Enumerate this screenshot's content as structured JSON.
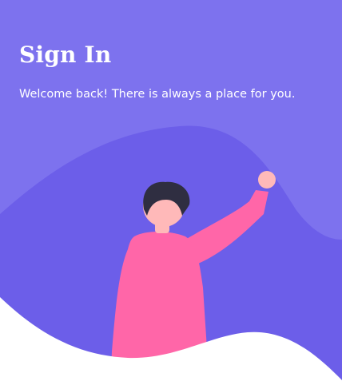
{
  "header": {
    "title": "Sign In",
    "subtitle": "Welcome back! There is always a place for you."
  },
  "illustration": {
    "subject": "waving-person",
    "colors": {
      "background_top": "#7d72ee",
      "background_wave": "#6c5ee9",
      "shirt": "#ff66a8",
      "skin": "#ffb9b9",
      "hair": "#2f2e41",
      "bottom_wave": "#ffffff"
    }
  }
}
